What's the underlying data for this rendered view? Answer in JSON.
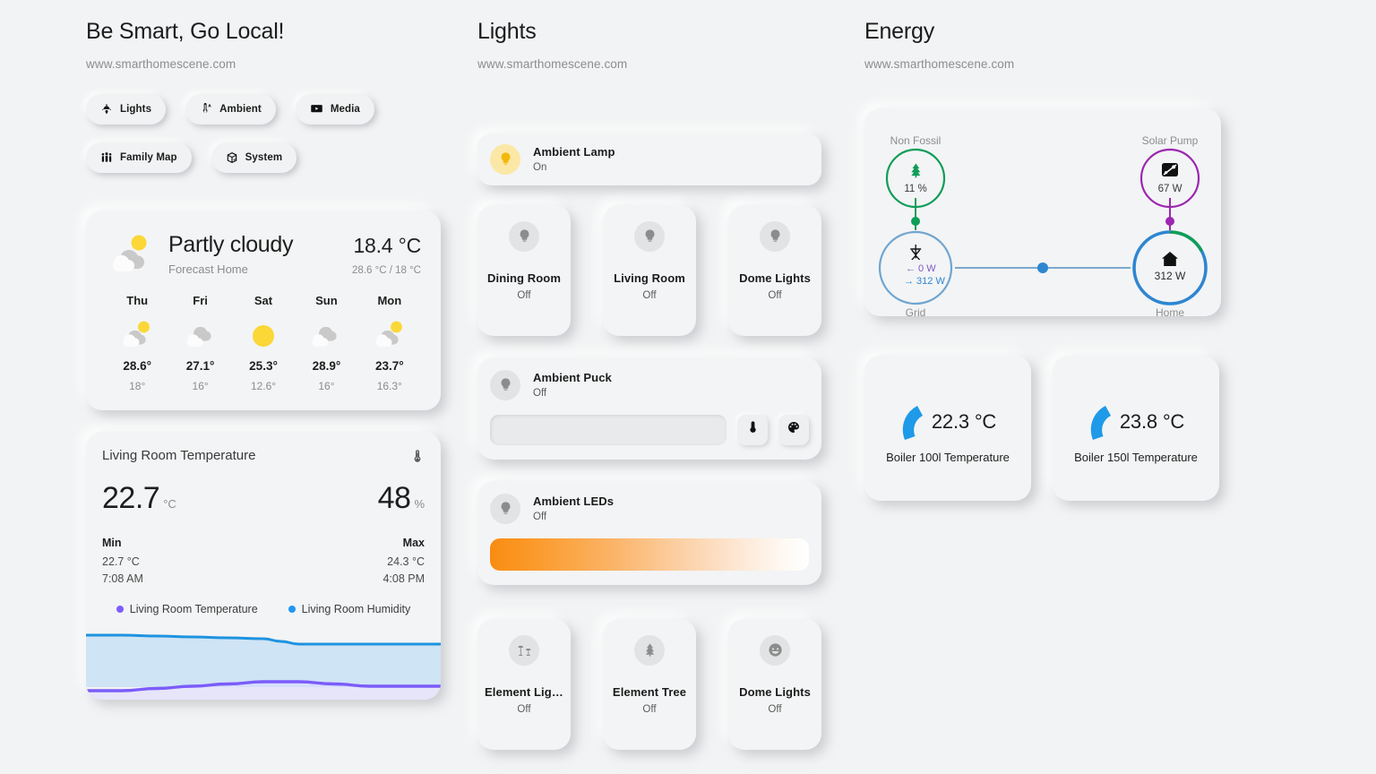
{
  "columns": {
    "left": {
      "title": "Be Smart, Go Local!",
      "subtitle": "www.smarthomescene.com"
    },
    "middle": {
      "title": "Lights",
      "subtitle": "www.smarthomescene.com"
    },
    "right": {
      "title": "Energy",
      "subtitle": "www.smarthomescene.com"
    }
  },
  "nav_chips": [
    {
      "label": "Lights",
      "icon": "ceiling-light-icon"
    },
    {
      "label": "Ambient",
      "icon": "thermometer-auto-icon"
    },
    {
      "label": "Media",
      "icon": "television-play-icon"
    },
    {
      "label": "Family Map",
      "icon": "account-group-icon"
    },
    {
      "label": "System",
      "icon": "package-check-icon"
    }
  ],
  "weather": {
    "icon": "partly-cloudy-icon",
    "state": "Partly cloudy",
    "entity": "Forecast Home",
    "temperature": "18.4 °C",
    "range": "28.6 °C / 18 °C",
    "forecast": [
      {
        "day": "Thu",
        "icon": "partly-cloudy-icon",
        "high": "28.6°",
        "low": "18°"
      },
      {
        "day": "Fri",
        "icon": "cloudy-icon",
        "high": "27.1°",
        "low": "16°"
      },
      {
        "day": "Sat",
        "icon": "sunny-icon",
        "high": "25.3°",
        "low": "12.6°"
      },
      {
        "day": "Sun",
        "icon": "cloudy-icon",
        "high": "28.9°",
        "low": "16°"
      },
      {
        "day": "Mon",
        "icon": "partly-cloudy-icon",
        "high": "23.7°",
        "low": "16.3°"
      }
    ]
  },
  "sensor_card": {
    "title": "Living Room Temperature",
    "icon": "thermometer-icon",
    "temperature": "22.7",
    "temperature_unit": "°C",
    "humidity": "48",
    "humidity_unit": "%",
    "min_label": "Min",
    "min_value": "22.7 °C",
    "min_time": "7:08 AM",
    "max_label": "Max",
    "max_value": "24.3 °C",
    "max_time": "4:08 PM",
    "legend": [
      {
        "label": "Living Room Temperature",
        "color": "#7c5cfc"
      },
      {
        "label": "Living Room Humidity",
        "color": "#2196f3"
      }
    ]
  },
  "chart_data": {
    "type": "area",
    "title": "Living Room Temperature",
    "xlabel": "",
    "ylabel": "",
    "grid": false,
    "legend_position": "top-center",
    "series": [
      {
        "name": "Living Room Humidity",
        "color": "#1e93e0",
        "fill": "#cfe4f5",
        "x": [
          0,
          10,
          20,
          30,
          40,
          50,
          55,
          60,
          70,
          80,
          90,
          100
        ],
        "values": [
          48.6,
          48.6,
          48.5,
          48.4,
          48.3,
          48.2,
          47.9,
          47.6,
          47.6,
          47.6,
          47.6,
          47.6
        ]
      },
      {
        "name": "Living Room Temperature",
        "color": "#7b5cfa",
        "fill": "#ddd8fd",
        "x": [
          0,
          10,
          20,
          30,
          40,
          50,
          60,
          70,
          80,
          90,
          100
        ],
        "values": [
          22.7,
          22.7,
          22.75,
          22.8,
          22.85,
          22.9,
          22.9,
          22.85,
          22.8,
          22.8,
          22.8
        ]
      }
    ]
  },
  "lights": {
    "ambient_lamp": {
      "name": "Ambient Lamp",
      "state": "On",
      "icon": "lightbulb-icon",
      "on": true
    },
    "row1": [
      {
        "name": "Dining Room",
        "state": "Off",
        "icon": "lightbulb-icon",
        "on": false
      },
      {
        "name": "Living Room",
        "state": "Off",
        "icon": "lightbulb-icon",
        "on": false
      },
      {
        "name": "Dome Lights",
        "state": "Off",
        "icon": "lightbulb-icon",
        "on": false
      }
    ],
    "ambient_puck": {
      "name": "Ambient Puck",
      "state": "Off",
      "icon": "lightbulb-icon",
      "brightness_slider": "brightness-slider",
      "buttons": [
        {
          "icon": "thermometer-icon",
          "name": "color-temp-button"
        },
        {
          "icon": "palette-icon",
          "name": "color-picker-button"
        }
      ]
    },
    "ambient_leds": {
      "name": "Ambient LEDs",
      "state": "Off",
      "icon": "lightbulb-icon",
      "gradient_from": "#f98c12",
      "gradient_to": "#ffffff"
    },
    "row2": [
      {
        "name": "Element Ligh…",
        "state": "Off",
        "icon": "floor-lamp-dual-icon",
        "on": false
      },
      {
        "name": "Element Tree",
        "state": "Off",
        "icon": "pine-tree-icon",
        "on": false
      },
      {
        "name": "Dome Lights",
        "state": "Off",
        "icon": "emoticon-icon",
        "on": false
      }
    ]
  },
  "energy": {
    "flow": {
      "non_fossil": {
        "label": "Non Fossil",
        "value": "11 %",
        "icon": "leaf-icon",
        "color": "#0f9d58"
      },
      "solar_pump": {
        "label": "Solar Pump",
        "value": "67 W",
        "icon": "solar-power-icon",
        "color": "#9c27b0"
      },
      "grid": {
        "label": "Grid",
        "in": "0 W",
        "out": "312 W",
        "icon": "transmission-tower-icon",
        "color": "#488fcb"
      },
      "home": {
        "label": "Home",
        "value": "312 W",
        "icon": "home-icon",
        "color": "#2e86d1"
      }
    },
    "boilers": [
      {
        "value": "22.3 °C",
        "label": "Boiler 100l Temperature",
        "gauge_color": "#1e9ae8"
      },
      {
        "value": "23.8 °C",
        "label": "Boiler 150l Temperature",
        "gauge_color": "#1e9ae8"
      }
    ]
  }
}
